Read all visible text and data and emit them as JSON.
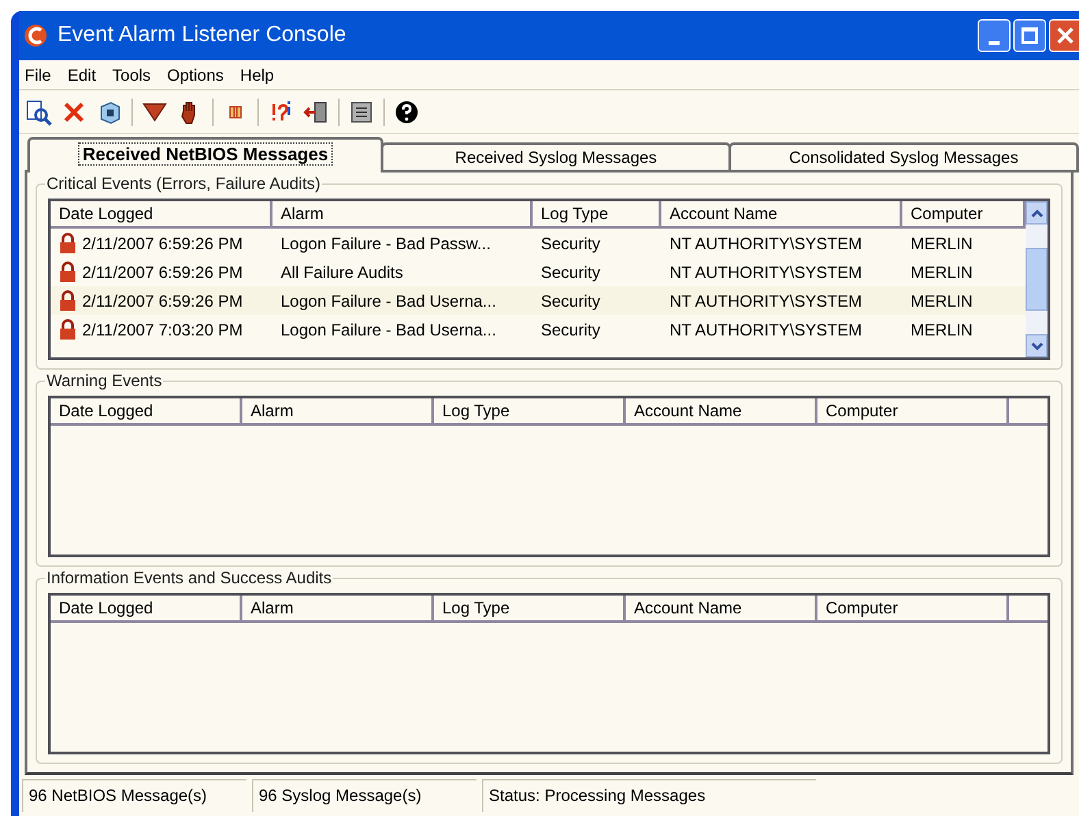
{
  "window": {
    "title": "Event Alarm Listener Console"
  },
  "menu": [
    "File",
    "Edit",
    "Tools",
    "Options",
    "Help"
  ],
  "tabs": [
    {
      "label": "Received NetBIOS Messages",
      "selected": true
    },
    {
      "label": "Received Syslog Messages",
      "selected": false
    },
    {
      "label": "Consolidated Syslog Messages",
      "selected": false
    }
  ],
  "groups": [
    {
      "title": "Critical Events (Errors, Failure Audits)",
      "columns": [
        "Date Logged",
        "Alarm",
        "Log Type",
        "Account Name",
        "Computer"
      ],
      "rows": [
        [
          "2/11/2007 6:59:26 PM",
          "Logon Failure - Bad Passw...",
          "Security",
          "NT AUTHORITY\\SYSTEM",
          "MERLIN"
        ],
        [
          "2/11/2007 6:59:26 PM",
          "All Failure Audits",
          "Security",
          "NT AUTHORITY\\SYSTEM",
          "MERLIN"
        ],
        [
          "2/11/2007 6:59:26 PM",
          "Logon Failure - Bad Userna...",
          "Security",
          "NT AUTHORITY\\SYSTEM",
          "MERLIN"
        ],
        [
          "2/11/2007 7:03:20 PM",
          "Logon Failure - Bad Userna...",
          "Security",
          "NT AUTHORITY\\SYSTEM",
          "MERLIN"
        ]
      ]
    },
    {
      "title": "Warning Events",
      "columns": [
        "Date Logged",
        "Alarm",
        "Log Type",
        "Account Name",
        "Computer"
      ]
    },
    {
      "title": "Information Events and Success Audits",
      "columns": [
        "Date Logged",
        "Alarm",
        "Log Type",
        "Account Name",
        "Computer"
      ]
    }
  ],
  "status_bar": [
    "96 NetBIOS Message(s)",
    "96 Syslog Message(s)",
    "Status: Processing Messages"
  ]
}
